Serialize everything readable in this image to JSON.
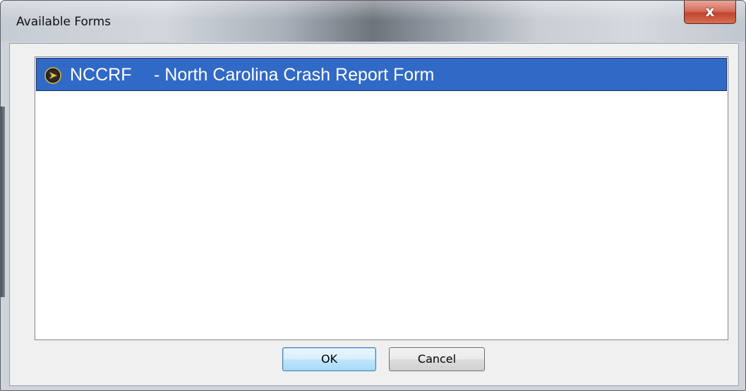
{
  "window": {
    "title": "Available Forms",
    "close_glyph": "x",
    "close_icon": "close-icon"
  },
  "list": {
    "items": [
      {
        "code": "NCCRF",
        "description": "- North Carolina Crash Report Form",
        "icon": "form-play-icon",
        "selected": true
      }
    ]
  },
  "buttons": {
    "ok_label": "OK",
    "cancel_label": "Cancel"
  },
  "colors": {
    "selection": "#3169c6",
    "close_button": "#c2452f",
    "ok_button_border": "#3c7fb1"
  }
}
